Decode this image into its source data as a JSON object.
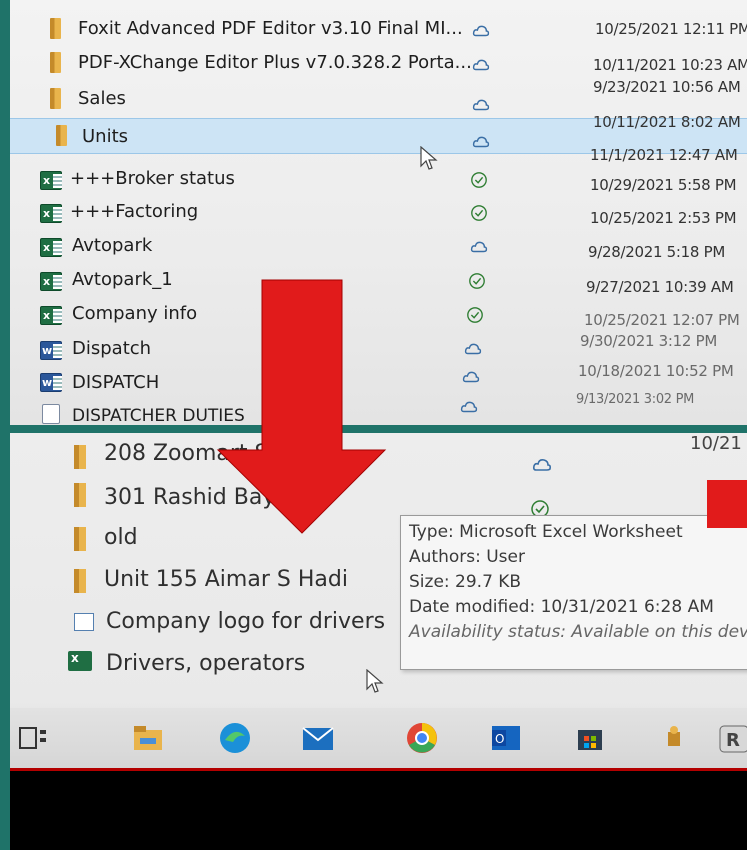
{
  "top_list": {
    "rows": [
      {
        "name": "Foxit Advanced PDF Editor v3.10 Final MI...",
        "type": "folder",
        "status": "cloud",
        "date": "10/25/2021 12:11 PM"
      },
      {
        "name": "PDF-XChange Editor Plus v7.0.328.2 Porta...",
        "type": "folder",
        "status": "cloud",
        "date": "10/11/2021 10:23 AM"
      },
      {
        "name": "Sales",
        "type": "folder",
        "status": "cloud",
        "date": "9/23/2021 10:56 AM"
      },
      {
        "name": "Units",
        "type": "folder",
        "status": "cloud",
        "date": "10/11/2021 8:02 AM"
      },
      {
        "name": "",
        "type": "none",
        "status": "cloud",
        "date": "11/1/2021 12:47 AM"
      },
      {
        "name": "+++Broker status",
        "type": "excel",
        "status": "check",
        "date": "10/29/2021 5:58 PM"
      },
      {
        "name": "+++Factoring",
        "type": "excel",
        "status": "check",
        "date": "10/25/2021 2:53 PM"
      },
      {
        "name": "Avtopark",
        "type": "excel",
        "status": "cloud",
        "date": "9/28/2021 5:18 PM"
      },
      {
        "name": "Avtopark_1",
        "type": "excel",
        "status": "check",
        "date": "9/27/2021 10:39 AM"
      },
      {
        "name": "Company info",
        "type": "excel",
        "status": "check",
        "date": "10/25/2021 12:07 PM"
      },
      {
        "name": "Dispatch",
        "type": "word",
        "status": "cloud",
        "date": "9/30/2021 3:12 PM"
      },
      {
        "name": "DISPATCH",
        "type": "word",
        "status": "cloud",
        "date": "10/18/2021 10:52 PM"
      },
      {
        "name": "DISPATCHER DUTIES",
        "type": "file",
        "status": "cloud",
        "date": "9/13/2021 3:02 PM"
      }
    ]
  },
  "bottom_list": {
    "rows": [
      {
        "name": "208 Zoomart Sa",
        "type": "folder"
      },
      {
        "name": "301 Rashid Bayra",
        "type": "folder"
      },
      {
        "name": "old",
        "type": "folder"
      },
      {
        "name": "Unit 155 Aimar S Hadi",
        "type": "folder"
      },
      {
        "name": "Company logo for drivers",
        "type": "image"
      },
      {
        "name": "Drivers, operators",
        "type": "excel"
      }
    ],
    "partial_date": "10/21"
  },
  "tooltip": {
    "type": "Type: Microsoft Excel Worksheet",
    "authors": "Authors: User",
    "size": "Size: 29.7 KB",
    "date_modified": "Date modified: 10/31/2021 6:28 AM",
    "availability": "Availability status: Available on this dev"
  },
  "taskbar": {
    "items": [
      "task-view-icon",
      "file-explorer-icon",
      "edge-icon",
      "mail-icon",
      "chrome-icon",
      "outlook-icon",
      "store-icon",
      "app-icon",
      "r-app-icon"
    ]
  },
  "colors": {
    "arrow": "#e11b1b",
    "selection": "#cde4f5",
    "excel": "#1f6e43",
    "word": "#2b579a",
    "folder": "#e9b44c",
    "background": "#1f7369"
  }
}
